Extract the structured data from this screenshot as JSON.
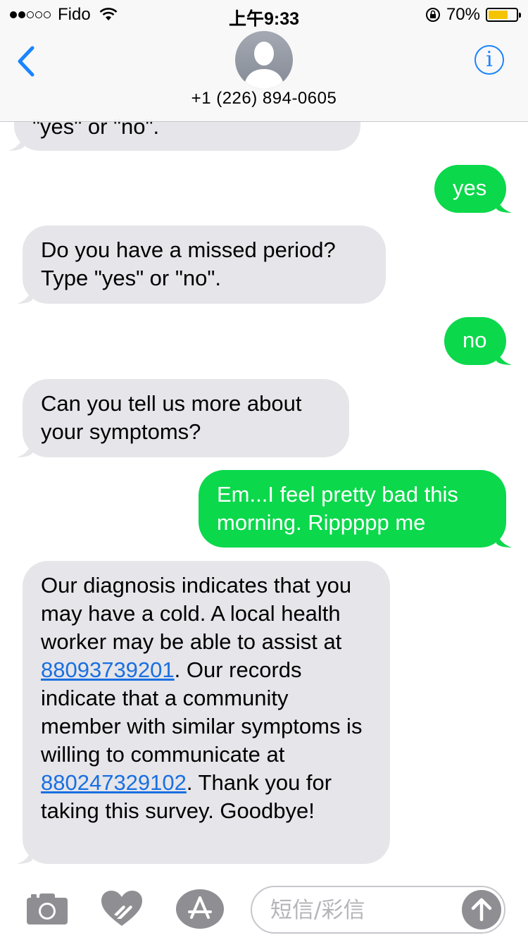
{
  "status_bar": {
    "carrier": "Fido",
    "time": "上午9:33",
    "battery_percent": "70%",
    "battery_level": 0.7,
    "signal_bars_filled": 2,
    "signal_bars_total": 5
  },
  "header": {
    "contact": "+1 (226) 894-0605",
    "info_label": "i"
  },
  "messages": [
    {
      "direction": "incoming",
      "text": "\"yes\" or \"no\"."
    },
    {
      "direction": "outgoing",
      "text": "yes"
    },
    {
      "direction": "incoming",
      "text": "Do you have a missed period? Type \"yes\" or \"no\"."
    },
    {
      "direction": "outgoing",
      "text": "no"
    },
    {
      "direction": "incoming",
      "text": "Can you tell us more about your symptoms?"
    },
    {
      "direction": "outgoing",
      "text": "Em...I feel pretty bad this morning. Rippppp me"
    },
    {
      "direction": "incoming",
      "text_part1": "Our diagnosis indicates that you may have a cold.  A local health worker may be able to assist at ",
      "link1": "88093739201",
      "text_part2": ". Our records indicate that a community member with similar symptoms is willing to communicate at ",
      "link2": "880247329102",
      "text_part3": ". Thank you for taking this survey. Goodbye!"
    }
  ],
  "compose": {
    "placeholder": "短信/彩信"
  },
  "icons": {
    "camera": "camera-icon",
    "digital_touch": "digital-touch-icon",
    "app_store": "app-store-icon",
    "send": "send-arrow-icon"
  },
  "colors": {
    "outgoing_bubble": "#0bd84b",
    "incoming_bubble": "#e5e5ea",
    "accent": "#1a84ff",
    "link": "#1a6fe0"
  }
}
